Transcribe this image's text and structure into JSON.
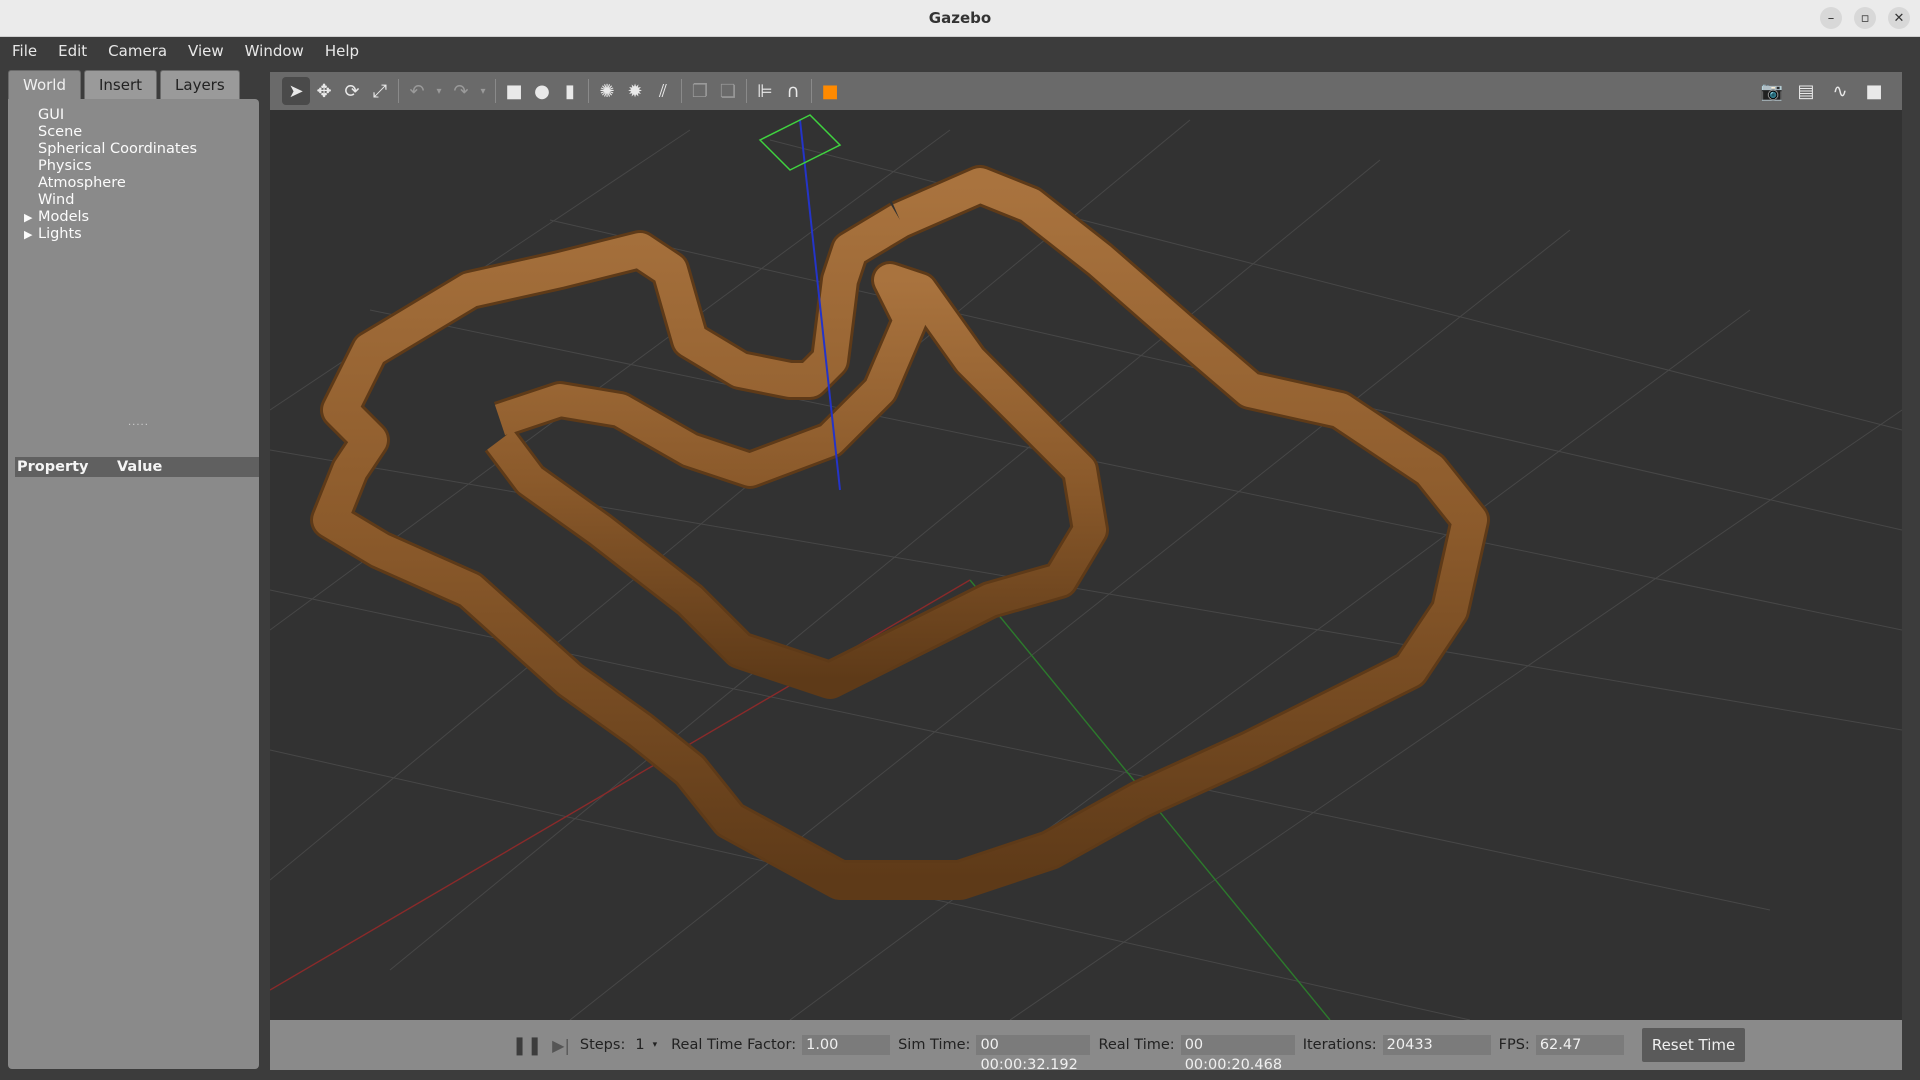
{
  "window": {
    "title": "Gazebo"
  },
  "menu": [
    "File",
    "Edit",
    "Camera",
    "View",
    "Window",
    "Help"
  ],
  "left_panel": {
    "tabs": [
      "World",
      "Insert",
      "Layers"
    ],
    "active_tab": "World",
    "tree": [
      {
        "label": "GUI",
        "expandable": false
      },
      {
        "label": "Scene",
        "expandable": false
      },
      {
        "label": "Spherical Coordinates",
        "expandable": false
      },
      {
        "label": "Physics",
        "expandable": false
      },
      {
        "label": "Atmosphere",
        "expandable": false
      },
      {
        "label": "Wind",
        "expandable": false
      },
      {
        "label": "Models",
        "expandable": true
      },
      {
        "label": "Lights",
        "expandable": true
      }
    ],
    "property_header": {
      "property": "Property",
      "value": "Value"
    }
  },
  "toolbar": {
    "left_icons": [
      "select-arrow-icon",
      "translate-icon",
      "rotate-icon",
      "scale-icon",
      "undo-icon",
      "undo-dropdown-icon",
      "redo-icon",
      "redo-dropdown-icon",
      "box-icon",
      "sphere-icon",
      "cylinder-icon",
      "point-light-icon",
      "spot-light-icon",
      "directional-light-icon",
      "copy-icon",
      "paste-icon",
      "align-icon",
      "snap-icon",
      "change-view-icon"
    ],
    "right_icons": [
      "screenshot-icon",
      "log-icon",
      "plot-icon",
      "video-record-icon"
    ]
  },
  "status": {
    "steps_label": "Steps:",
    "steps_value": "1",
    "rtf_label": "Real Time Factor:",
    "rtf_value": "1.00",
    "sim_time_label": "Sim Time:",
    "sim_time_value": "00 00:00:32.192",
    "real_time_label": "Real Time:",
    "real_time_value": "00 00:00:20.468",
    "iterations_label": "Iterations:",
    "iterations_value": "20433",
    "fps_label": "FPS:",
    "fps_value": "62.47",
    "reset_label": "Reset Time"
  }
}
